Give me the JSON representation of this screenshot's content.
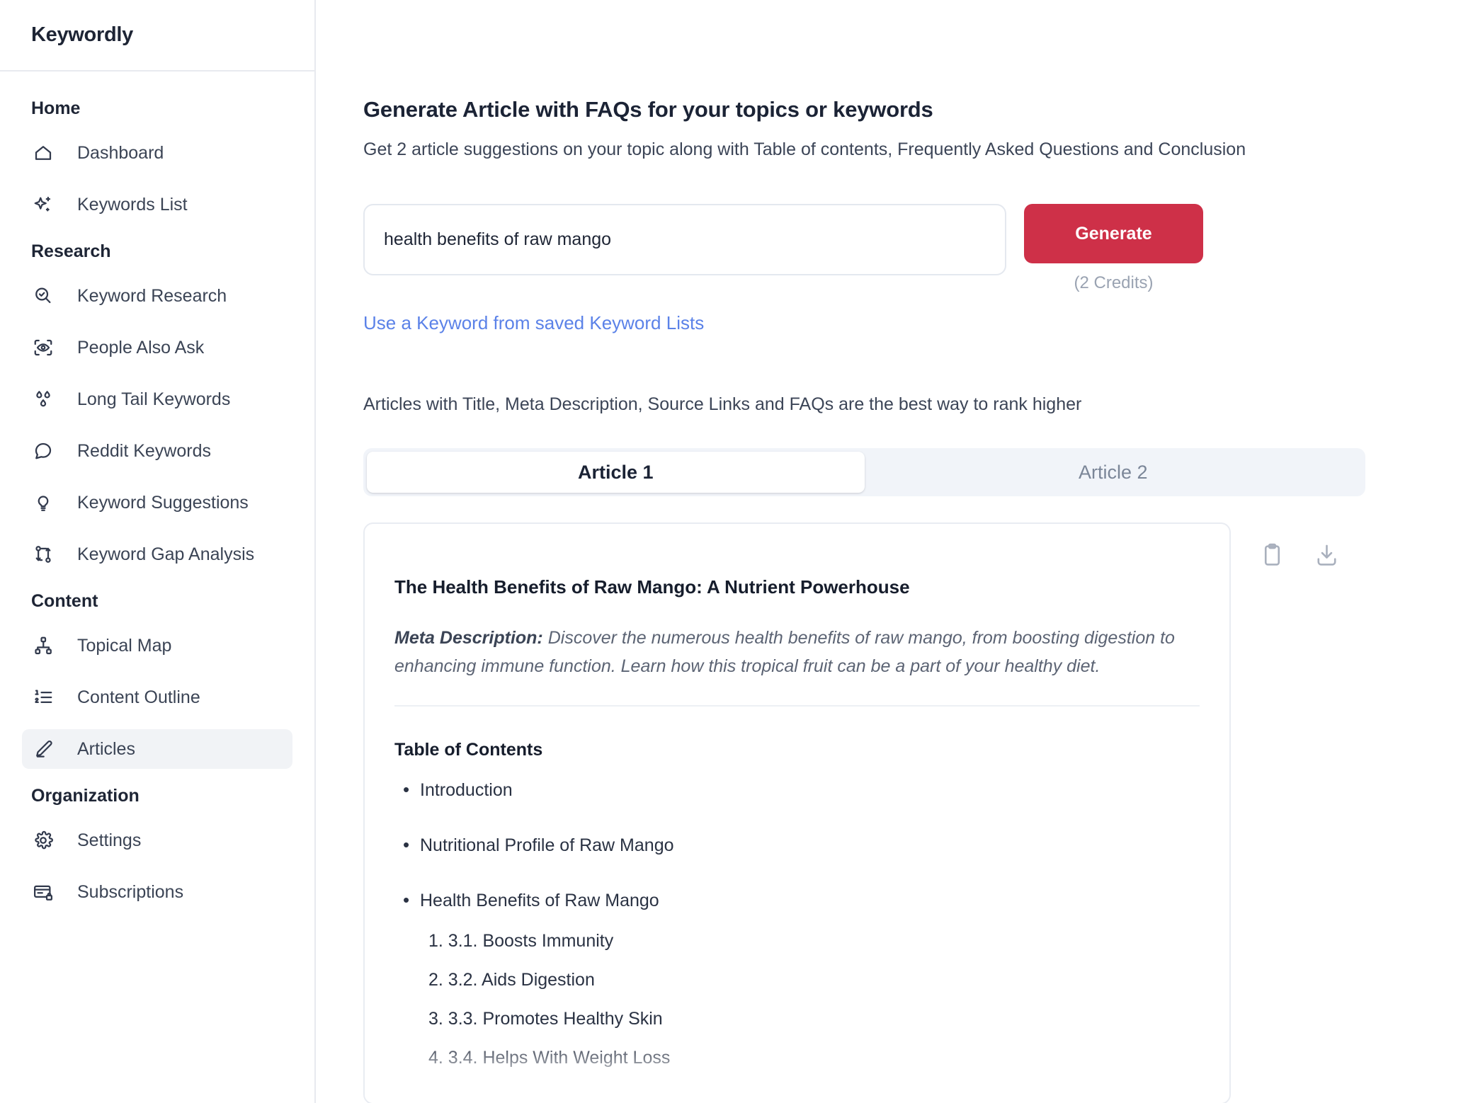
{
  "app": {
    "brand": "Keywordly"
  },
  "sidebar": {
    "groups": [
      {
        "label": "Home",
        "items": [
          {
            "label": "Dashboard",
            "icon": "home-icon"
          },
          {
            "label": "Keywords List",
            "icon": "sparkle-icon"
          }
        ]
      },
      {
        "label": "Research",
        "items": [
          {
            "label": "Keyword Research",
            "icon": "search-check-icon"
          },
          {
            "label": "People Also Ask",
            "icon": "eye-scan-icon"
          },
          {
            "label": "Long Tail Keywords",
            "icon": "droplets-icon"
          },
          {
            "label": "Reddit Keywords",
            "icon": "message-circle-icon"
          },
          {
            "label": "Keyword Suggestions",
            "icon": "lightbulb-icon"
          },
          {
            "label": "Keyword Gap Analysis",
            "icon": "git-compare-icon"
          }
        ]
      },
      {
        "label": "Content",
        "items": [
          {
            "label": "Topical Map",
            "icon": "network-icon"
          },
          {
            "label": "Content Outline",
            "icon": "list-ordered-icon"
          },
          {
            "label": "Articles",
            "icon": "pencil-icon",
            "active": true
          }
        ]
      },
      {
        "label": "Organization",
        "items": [
          {
            "label": "Settings",
            "icon": "gear-icon"
          },
          {
            "label": "Subscriptions",
            "icon": "credit-card-lock-icon"
          }
        ]
      }
    ]
  },
  "main": {
    "title": "Generate Article with FAQs for your topics or keywords",
    "subtitle": "Get 2 article suggestions on your topic along with Table of contents, Frequently Asked Questions and Conclusion",
    "keyword_input": {
      "value": "health benefits of raw mango",
      "placeholder": "Enter a keyword or topic"
    },
    "generate_button": "Generate",
    "credits_note": "(2 Credits)",
    "saved_keywords_link": "Use a Keyword from saved Keyword Lists",
    "rank_note": "Articles with Title, Meta Description, Source Links and FAQs are the best way to rank higher",
    "tabs": [
      {
        "label": "Article 1",
        "active": true
      },
      {
        "label": "Article 2",
        "active": false
      }
    ],
    "article": {
      "title": "The Health Benefits of Raw Mango: A Nutrient Powerhouse",
      "meta_label": "Meta Description:",
      "meta_text": " Discover the numerous health benefits of raw mango, from boosting digestion to enhancing immune function. Learn how this tropical fruit can be a part of your healthy diet.",
      "toc_heading": "Table of Contents",
      "toc": [
        {
          "text": "Introduction",
          "children": []
        },
        {
          "text": "Nutritional Profile of Raw Mango",
          "children": []
        },
        {
          "text": "Health Benefits of Raw Mango",
          "children": [
            "1. 3.1. Boosts Immunity",
            "2. 3.2. Aids Digestion",
            "3. 3.3. Promotes Healthy Skin",
            "4. 3.4. Helps With Weight Loss"
          ]
        }
      ]
    },
    "actions": {
      "copy": "copy-icon",
      "download": "download-icon"
    }
  },
  "colors": {
    "accent_red": "#ce3048",
    "link_blue": "#5b82e8",
    "text_dark": "#1b2335",
    "muted": "#9aa3b2",
    "tab_track": "#f1f4f9"
  }
}
